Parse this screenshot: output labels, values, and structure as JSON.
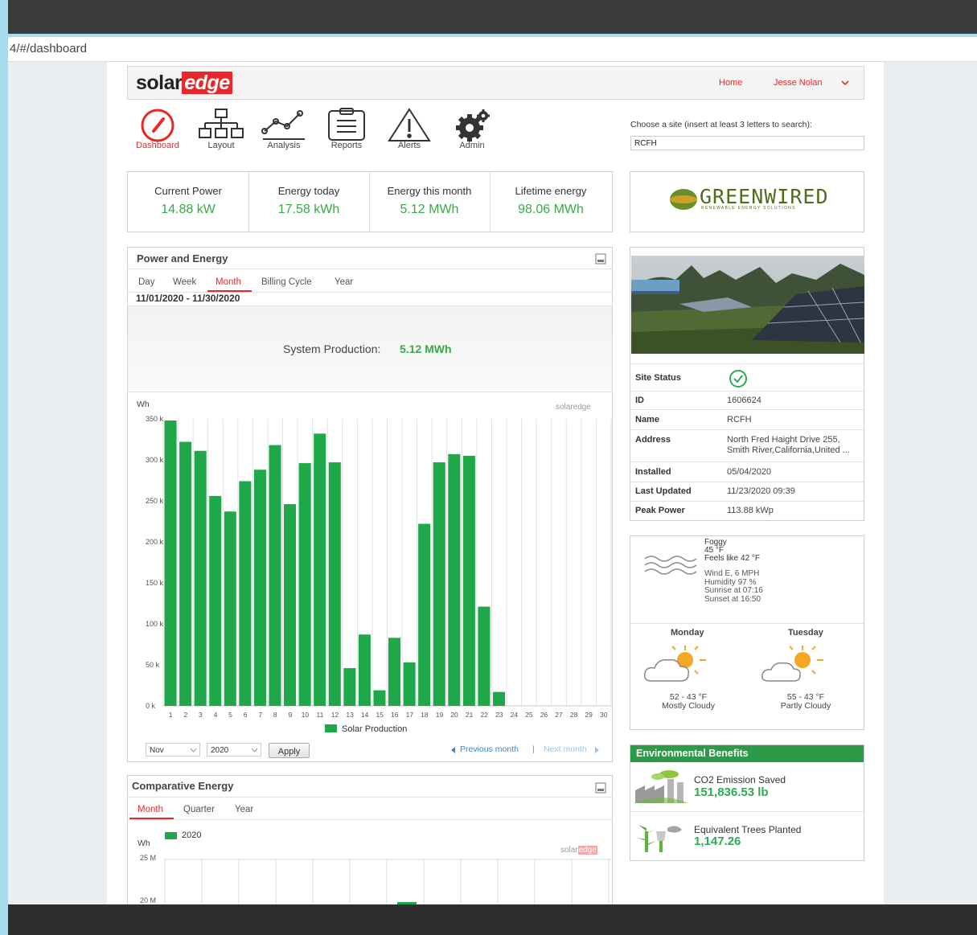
{
  "browser": {
    "url": "4/#/dashboard"
  },
  "header": {
    "logo_part1": "solar",
    "logo_part2": "edge",
    "home": "Home",
    "user": "Jesse Nolan"
  },
  "nav": {
    "items": [
      {
        "label": "Dashboard",
        "icon": "speedometer-icon",
        "active": true
      },
      {
        "label": "Layout",
        "icon": "layout-tree-icon"
      },
      {
        "label": "Analysis",
        "icon": "line-chart-icon"
      },
      {
        "label": "Reports",
        "icon": "clipboard-icon"
      },
      {
        "label": "Alerts",
        "icon": "warning-icon"
      },
      {
        "label": "Admin",
        "icon": "gears-icon"
      }
    ]
  },
  "site_search": {
    "label": "Choose a site (insert at least 3 letters to search):",
    "value": "RCFH"
  },
  "kpis": [
    {
      "title": "Current Power",
      "value": "14.88 kW"
    },
    {
      "title": "Energy today",
      "value": "17.58 kWh"
    },
    {
      "title": "Energy this month",
      "value": "5.12 MWh"
    },
    {
      "title": "Lifetime energy",
      "value": "98.06 MWh"
    }
  ],
  "brand": {
    "name": "GREENWIRED",
    "tagline": "RENEWABLE ENERGY SOLUTIONS"
  },
  "power_energy": {
    "title": "Power and Energy",
    "tabs": [
      "Day",
      "Week",
      "Month",
      "Billing Cycle",
      "Year"
    ],
    "active_tab": "Month",
    "date_range": "11/01/2020 - 11/30/2020",
    "production_label": "System Production:",
    "production_value": "5.12 MWh",
    "month_select": "Nov",
    "year_select": "2020",
    "apply": "Apply",
    "prev": "Previous month",
    "divider": "|",
    "next": "Next month",
    "watermark": "solaredge"
  },
  "chart_data": {
    "type": "bar",
    "ylabel": "Wh",
    "ylim": [
      0,
      350000
    ],
    "yticks": [
      0,
      50000,
      100000,
      150000,
      200000,
      250000,
      300000,
      350000
    ],
    "ytick_labels": [
      "0 k",
      "50 k",
      "100 k",
      "150 k",
      "200 k",
      "250 k",
      "300 k",
      "350 k"
    ],
    "categories": [
      "1",
      "2",
      "3",
      "4",
      "5",
      "6",
      "7",
      "8",
      "9",
      "10",
      "11",
      "12",
      "13",
      "14",
      "15",
      "16",
      "17",
      "18",
      "19",
      "20",
      "21",
      "22",
      "23",
      "24",
      "25",
      "26",
      "27",
      "28",
      "29",
      "30"
    ],
    "series": [
      {
        "name": "Solar Production",
        "color": "#1fa84a",
        "values": [
          348000,
          322000,
          311000,
          256000,
          237000,
          274000,
          288000,
          318000,
          246000,
          296000,
          332000,
          297000,
          46000,
          87000,
          19000,
          83000,
          53000,
          222000,
          297000,
          307000,
          305000,
          121000,
          17000,
          null,
          null,
          null,
          null,
          null,
          null,
          null
        ]
      }
    ],
    "legend": "bottom",
    "grid": true
  },
  "comparative": {
    "title": "Comparative Energy",
    "tabs": [
      "Month",
      "Quarter",
      "Year"
    ],
    "active_tab": "Month",
    "legend": "2020",
    "ylabel": "Wh",
    "yticks": [
      "25 M",
      "20 M"
    ]
  },
  "site": {
    "rows": [
      {
        "label": "Site Status",
        "value": ""
      },
      {
        "label": "ID",
        "value": "1606624"
      },
      {
        "label": "Name",
        "value": "RCFH"
      },
      {
        "label": "Address",
        "value": "North Fred Haight Drive 255,",
        "value2": "Smith River,California,United ..."
      },
      {
        "label": "Installed",
        "value": "05/04/2020"
      },
      {
        "label": "Last Updated",
        "value": "11/23/2020 09:39"
      },
      {
        "label": "Peak Power",
        "value": "113.88 kWp"
      }
    ]
  },
  "weather": {
    "condition": "Foggy",
    "temp": "45 °F",
    "feels": "Feels like 42 °F",
    "wind": "Wind E, 6 MPH",
    "humidity": "Humidity 97 %",
    "sunrise": "Sunrise at 07:16",
    "sunset": "Sunset at 16:50",
    "forecast": [
      {
        "day": "Monday",
        "range": "52 - 43 °F",
        "desc": "Mostly Cloudy"
      },
      {
        "day": "Tuesday",
        "range": "55 - 43 °F",
        "desc": "Partly Cloudy"
      }
    ]
  },
  "env": {
    "title": "Environmental Benefits",
    "co2_label": "CO2 Emission Saved",
    "co2_value": "151,836.53 lb",
    "trees_label": "Equivalent Trees Planted",
    "trees_value": "1,147.26"
  }
}
